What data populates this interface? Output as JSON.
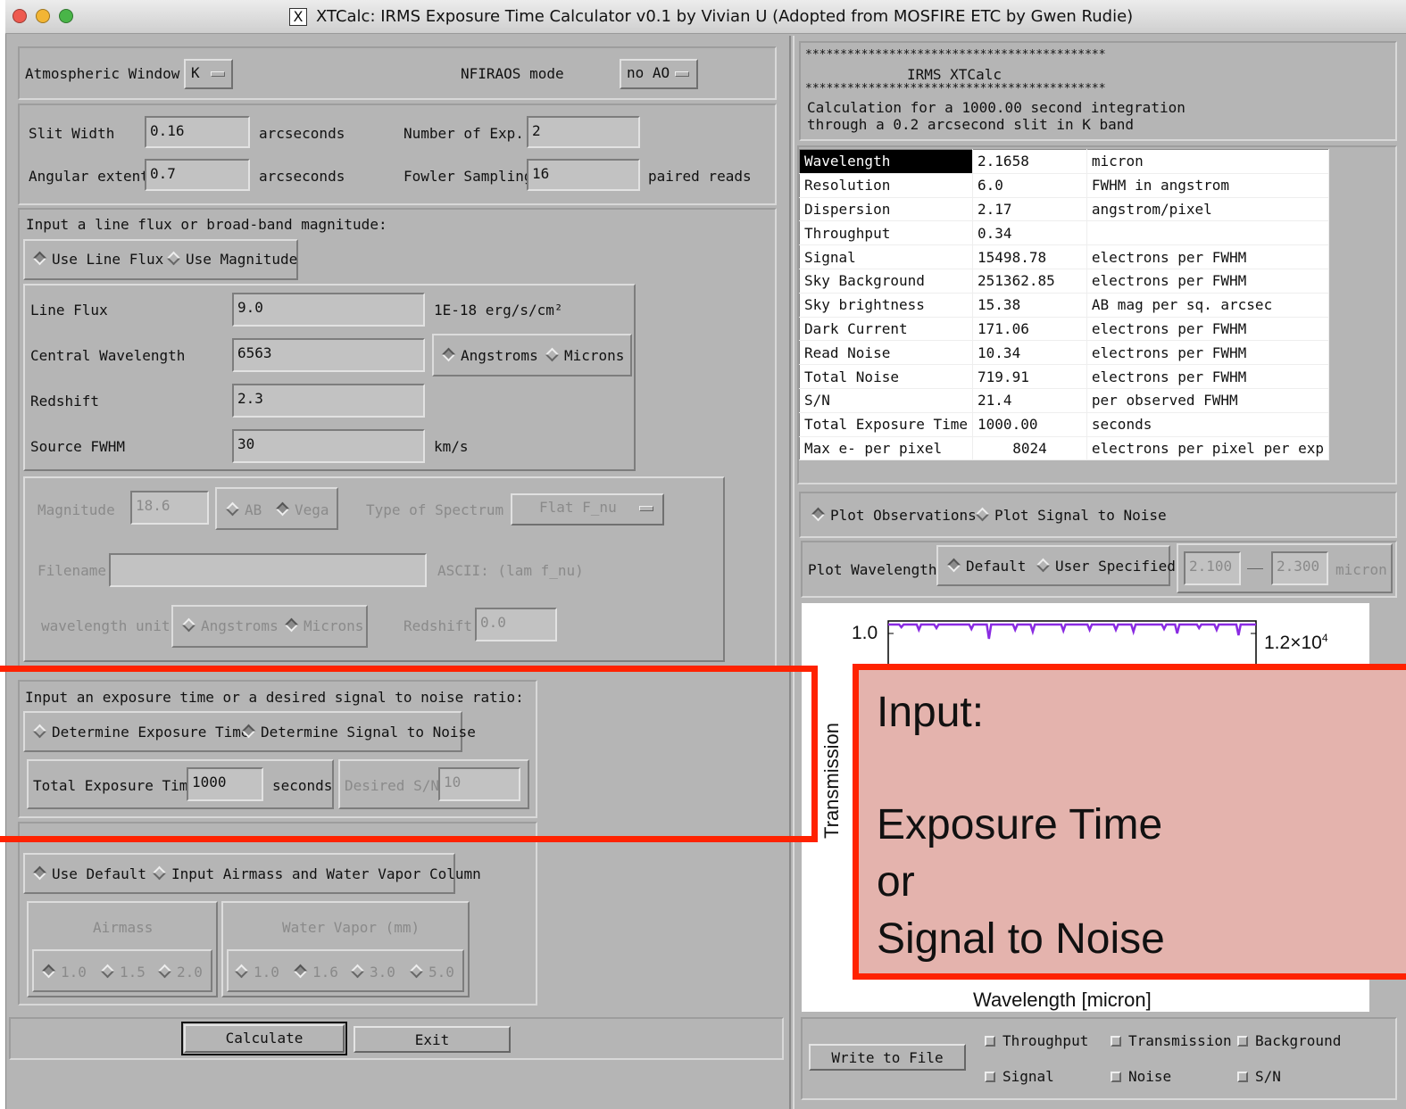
{
  "window": {
    "title": "XTCalc: IRMS Exposure Time Calculator v0.1 by Vivian U (Adopted from MOSFIRE ETC by Gwen Rudie)",
    "x_glyph": "X"
  },
  "left": {
    "atmospheric_window_label": "Atmospheric Window",
    "atmospheric_window_value": "K",
    "nfiraos_label": "NFIRAOS mode",
    "nfiraos_value": "no AO",
    "slit_width_label": "Slit Width",
    "slit_width_value": "0.16",
    "slit_width_unit": "arcseconds",
    "angular_extent_label": "Angular extent",
    "angular_extent_value": "0.7",
    "angular_extent_unit": "arcseconds",
    "num_exp_label": "Number of Exp.",
    "num_exp_value": "2",
    "fowler_label": "Fowler Sampling",
    "fowler_value": "16",
    "fowler_unit": "paired reads",
    "flux_section_title": "Input a line flux or broad-band magnitude:",
    "use_line_flux": "Use Line Flux",
    "use_magnitude": "Use Magnitude",
    "line_flux_label": "Line Flux",
    "line_flux_value": "9.0",
    "line_flux_unit": "1E-18 erg/s/cm²",
    "central_wl_label": "Central Wavelength",
    "central_wl_value": "6563",
    "angstroms": "Angstroms",
    "microns": "Microns",
    "redshift_label": "Redshift",
    "redshift_value": "2.3",
    "source_fwhm_label": "Source FWHM",
    "source_fwhm_value": "30",
    "source_fwhm_unit": "km/s",
    "magnitude_label": "Magnitude",
    "magnitude_value": "18.6",
    "ab": "AB",
    "vega": "Vega",
    "spectrum_type_label": "Type of Spectrum",
    "spectrum_type_value": "Flat F_nu",
    "filename_label": "Filename",
    "ascii_label": "ASCII: (lam f_nu)",
    "wl_unit_label": "wavelength unit",
    "wl_unit_angstroms": "Angstroms",
    "wl_unit_microns": "Microns",
    "redshift2_label": "Redshift",
    "redshift2_value": "0.0",
    "exp_section_title": "Input an exposure time or a desired signal to noise ratio:",
    "determine_exp": "Determine Exposure Time",
    "determine_sn": "Determine Signal to Noise",
    "total_exp_label": "Total Exposure Time",
    "total_exp_value": "1000",
    "total_exp_unit": "seconds",
    "desired_sn_label": "Desired S/N",
    "desired_sn_value": "10",
    "use_default": "Use Default",
    "input_airmass": "Input Airmass and Water Vapor Column",
    "airmass_label": "Airmass",
    "airmass_opts": [
      "1.0",
      "1.5",
      "2.0"
    ],
    "water_label": "Water Vapor (mm)",
    "water_opts": [
      "1.0",
      "1.6",
      "3.0",
      "5.0"
    ],
    "calculate": "Calculate",
    "exit": "Exit"
  },
  "right": {
    "stars": "*******************************************",
    "header_title": "IRMS XTCalc",
    "calc_line1": "Calculation for a 1000.00 second integration",
    "calc_line2": "through a 0.2 arcsecond slit in K band",
    "results": [
      {
        "k": "Wavelength",
        "v": "2.1658",
        "u": "micron"
      },
      {
        "k": "Resolution",
        "v": "6.0",
        "u": "FWHM in angstrom"
      },
      {
        "k": "Dispersion",
        "v": "2.17",
        "u": "angstrom/pixel"
      },
      {
        "k": "Throughput",
        "v": "0.34",
        "u": ""
      },
      {
        "k": "Signal",
        "v": "15498.78",
        "u": "electrons per FWHM"
      },
      {
        "k": "Sky Background",
        "v": "251362.85",
        "u": "electrons per FWHM"
      },
      {
        "k": "Sky brightness",
        "v": "15.38",
        "u": "AB mag per sq. arcsec"
      },
      {
        "k": "Dark Current",
        "v": "171.06",
        "u": "electrons per FWHM"
      },
      {
        "k": "Read Noise",
        "v": "10.34",
        "u": "electrons per FWHM"
      },
      {
        "k": "Total Noise",
        "v": "719.91",
        "u": "electrons per FWHM"
      },
      {
        "k": "S/N",
        "v": "21.4",
        "u": "per observed FWHM"
      },
      {
        "k": "Total Exposure Time",
        "v": "1000.00",
        "u": "seconds"
      },
      {
        "k": "Max e- per pixel",
        "v": "8024",
        "u": "electrons per pixel per exp"
      }
    ],
    "plot_obs": "Plot Observations",
    "plot_sn": "Plot Signal to Noise",
    "plot_wl_label": "Plot Wavelengths",
    "default": "Default",
    "user_specified": "User Specified",
    "wl_min": "2.100",
    "wl_max": "2.300",
    "wl_unit": "micron",
    "plot_y_tick": "1.0",
    "plot_y2_tick": "1.2×10",
    "plot_y2_exp": "4",
    "plot_ylabel": "Transmission",
    "plot_xlabel": "Wavelength [micron]",
    "write_to_file": "Write to File",
    "chk_throughput": "Throughput",
    "chk_transmission": "Transmission",
    "chk_background": "Background",
    "chk_signal": "Signal",
    "chk_noise": "Noise",
    "chk_sn": "S/N",
    "plot_color": "#8a2be2"
  },
  "annotation": {
    "line1": "Input:",
    "line2": "Exposure Time",
    "line3": "or",
    "line4": "Signal to Noise",
    "color": "#ff2200"
  }
}
